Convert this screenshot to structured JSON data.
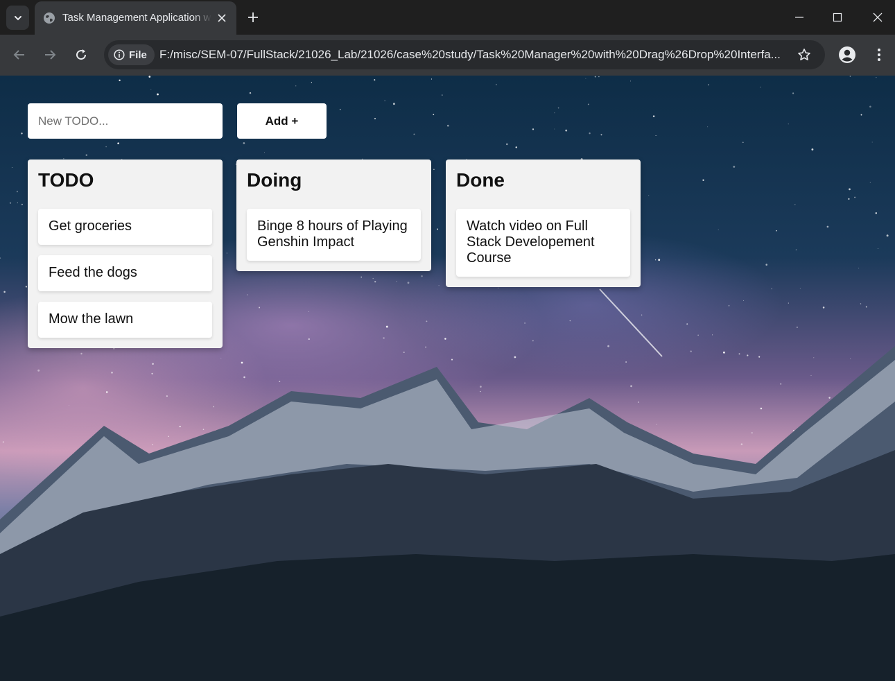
{
  "browser": {
    "tab_title": "Task Management Application w",
    "site_chip_label": "File",
    "url": "F:/misc/SEM-07/FullStack/21026_Lab/21026/case%20study/Task%20Manager%20with%20Drag%26Drop%20Interfa..."
  },
  "todo_form": {
    "placeholder": "New TODO...",
    "add_label": "Add +"
  },
  "columns": [
    {
      "title": "TODO",
      "cards": [
        "Get groceries",
        "Feed the dogs",
        "Mow the lawn"
      ]
    },
    {
      "title": "Doing",
      "cards": [
        "Binge 8 hours of Playing Genshin Impact"
      ]
    },
    {
      "title": "Done",
      "cards": [
        "Watch video on Full Stack Developement Course"
      ]
    }
  ]
}
